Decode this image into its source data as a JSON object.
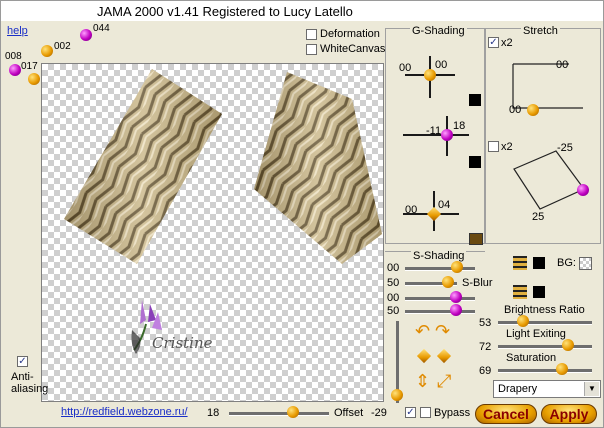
{
  "window": {
    "title": "JAMA 2000   v1.41  Registered to Lucy Latello"
  },
  "top": {
    "help": "help",
    "val_044": "044",
    "val_002": "002",
    "val_008": "008",
    "val_017": "017",
    "deformation": "Deformation",
    "whitecanvas": "WhiteCanvas"
  },
  "watermark": {
    "text": "Cristine"
  },
  "gshading": {
    "title": "G-Shading",
    "top_left": "00",
    "top_right": "00",
    "mid_left": "-11",
    "mid_right": "18",
    "bot_left": "00",
    "bot_right": "04"
  },
  "stretch": {
    "title": "Stretch",
    "x2_top": "x2",
    "x2_bottom": "x2",
    "top_val_right": "00",
    "top_val_left": "00",
    "bot_val_top": "-25",
    "bot_val_bottom": "25"
  },
  "sshading": {
    "title": "S-Shading",
    "v1": "00",
    "v2": "50",
    "v3": "00",
    "v4": "50",
    "sblur": "S-Blur",
    "bg": "BG:",
    "brightness_label": "Brightness Ratio",
    "brightness_val": "53",
    "light_label": "Light Exiting",
    "light_val": "72",
    "saturation_label": "Saturation",
    "saturation_val": "69"
  },
  "dropdown": {
    "selected": "Drapery"
  },
  "bottom": {
    "url": "http://redfield.webzone.ru/",
    "offset_left": "18",
    "offset_label": "Offset",
    "offset_right": "-29",
    "bypass": "Bypass",
    "cancel": "Cancel",
    "apply": "Apply",
    "antialias": "Anti-\naliasing"
  },
  "colors": {
    "accent": "#e89a00",
    "purple": "#c000c0",
    "text_link": "#1a2ec7"
  }
}
